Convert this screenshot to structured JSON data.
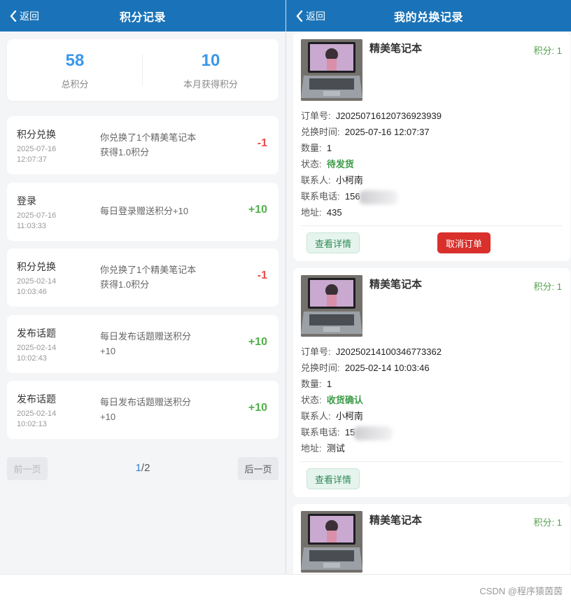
{
  "left": {
    "header": {
      "back_label": "返回",
      "title": "积分记录"
    },
    "summary": {
      "total_points": "58",
      "total_label": "总积分",
      "month_points": "10",
      "month_label": "本月获得积分"
    },
    "records": [
      {
        "type": "积分兑换",
        "date": "2025-07-16",
        "time": "12:07:37",
        "desc": "你兑换了1个精美笔记本获得1.0积分",
        "delta": "-1"
      },
      {
        "type": "登录",
        "date": "2025-07-16",
        "time": "11:03:33",
        "desc": "每日登录赠送积分+10",
        "delta": "+10"
      },
      {
        "type": "积分兑换",
        "date": "2025-02-14",
        "time": "10:03:46",
        "desc": "你兑换了1个精美笔记本获得1.0积分",
        "delta": "-1"
      },
      {
        "type": "发布话题",
        "date": "2025-02-14",
        "time": "10:02:43",
        "desc": "每日发布话题赠送积分+10",
        "delta": "+10"
      },
      {
        "type": "发布话题",
        "date": "2025-02-14",
        "time": "10:02:13",
        "desc": "每日发布话题赠送积分+10",
        "delta": "+10"
      }
    ],
    "pager": {
      "prev_label": "前一页",
      "current": "1",
      "total": "/2",
      "next_label": "后一页"
    }
  },
  "right": {
    "header": {
      "back_label": "返回",
      "title": "我的兑换记录"
    },
    "labels": {
      "order_no": "订单号:",
      "time": "兑换时间:",
      "qty": "数量:",
      "status": "状态:",
      "contact": "联系人:",
      "phone": "联系电话:",
      "address": "地址:",
      "detail_btn": "查看详情",
      "cancel_btn": "取消订单"
    },
    "orders": [
      {
        "name": "精美笔记本",
        "points": "积分: 1",
        "order_no": "J20250716120736923939",
        "time": "2025-07-16 12:07:37",
        "qty": "1",
        "status": "待发货",
        "contact": "小柯南",
        "phone": "156",
        "address": "435"
      },
      {
        "name": "精美笔记本",
        "points": "积分: 1",
        "order_no": "J20250214100346773362",
        "time": "2025-02-14 10:03:46",
        "qty": "1",
        "status": "收货确认",
        "contact": "小柯南",
        "phone": "15",
        "address": "测试"
      },
      {
        "name": "精美笔记本",
        "points": "积分: 1"
      }
    ]
  },
  "watermark": "CSDN @程序猿茵茵",
  "colors": {
    "header": "#1a73b8",
    "accent": "#3a97eb",
    "negative": "#ea4d4d",
    "positive": "#52b04a",
    "cancel": "#d9302c"
  }
}
